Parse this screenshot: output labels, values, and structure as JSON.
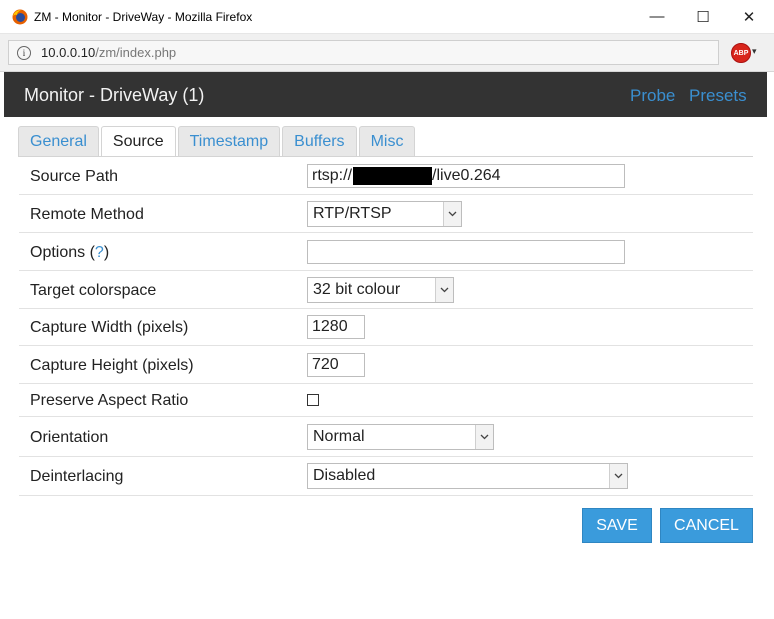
{
  "window": {
    "title": "ZM - Monitor - DriveWay - Mozilla Firefox",
    "min_glyph": "—",
    "max_glyph": "☐",
    "close_glyph": "✕"
  },
  "browser": {
    "url_host": "10.0.0.10",
    "url_path": "/zm/index.php",
    "info_glyph": "i",
    "abp_label": "ABP",
    "abp_caret": "▾"
  },
  "header": {
    "title": "Monitor - DriveWay (1)",
    "probe": "Probe",
    "presets": "Presets"
  },
  "tabs": [
    {
      "label": "General"
    },
    {
      "label": "Source",
      "active": true
    },
    {
      "label": "Timestamp"
    },
    {
      "label": "Buffers"
    },
    {
      "label": "Misc"
    }
  ],
  "form": {
    "source_path": {
      "label": "Source Path",
      "value_prefix": "rtsp://",
      "value_suffix": "/live0.264"
    },
    "remote_method": {
      "label": "Remote Method",
      "value": "RTP/RTSP"
    },
    "options": {
      "label": "Options (",
      "help": "?",
      "label_end": ")",
      "value": ""
    },
    "target_colorspace": {
      "label": "Target colorspace",
      "value": "32 bit colour"
    },
    "capture_width": {
      "label": "Capture Width (pixels)",
      "value": "1280"
    },
    "capture_height": {
      "label": "Capture Height (pixels)",
      "value": "720"
    },
    "preserve_aspect": {
      "label": "Preserve Aspect Ratio",
      "checked": false
    },
    "orientation": {
      "label": "Orientation",
      "value": "Normal"
    },
    "deinterlacing": {
      "label": "Deinterlacing",
      "value": "Disabled"
    }
  },
  "buttons": {
    "save": "SAVE",
    "cancel": "CANCEL"
  },
  "colors": {
    "header_bg": "#333333",
    "link": "#3a8fd0",
    "button_bg": "#3a9bdc"
  }
}
